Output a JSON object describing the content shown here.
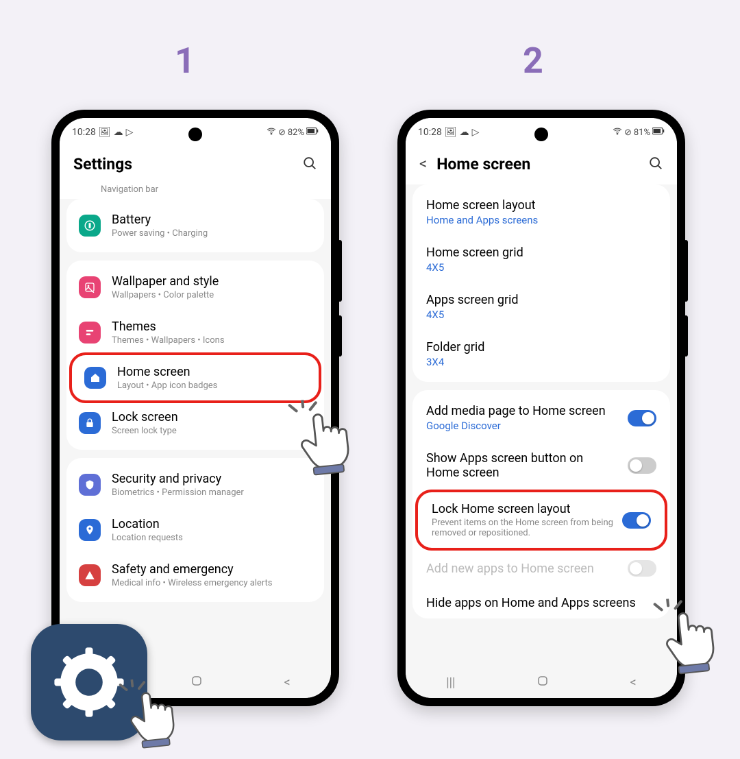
{
  "steps": {
    "s1": "1",
    "s2": "2"
  },
  "status": {
    "time1": "10:28",
    "time2": "10:28",
    "batt1": "82%",
    "batt2": "81%"
  },
  "screen1": {
    "title": "Settings",
    "crumb": "Navigation bar",
    "items": {
      "battery": {
        "title": "Battery",
        "sub": "Power saving  •  Charging"
      },
      "wallpaper": {
        "title": "Wallpaper and style",
        "sub": "Wallpapers  •  Color palette"
      },
      "themes": {
        "title": "Themes",
        "sub": "Themes  •  Wallpapers  •  Icons"
      },
      "home": {
        "title": "Home screen",
        "sub": "Layout  •  App icon badges"
      },
      "lock": {
        "title": "Lock screen",
        "sub": "Screen lock type"
      },
      "security": {
        "title": "Security and privacy",
        "sub": "Biometrics  •  Permission manager"
      },
      "location": {
        "title": "Location",
        "sub": "Location requests"
      },
      "safety": {
        "title": "Safety and emergency",
        "sub": "Medical info  •  Wireless emergency alerts"
      }
    }
  },
  "screen2": {
    "title": "Home screen",
    "items": {
      "layout": {
        "title": "Home screen layout",
        "sub": "Home and Apps screens"
      },
      "hgrid": {
        "title": "Home screen grid",
        "sub": "4X5"
      },
      "agrid": {
        "title": "Apps screen grid",
        "sub": "4X5"
      },
      "fgrid": {
        "title": "Folder grid",
        "sub": "3X4"
      },
      "media": {
        "title": "Add media page to Home screen",
        "sub": "Google Discover"
      },
      "showapps": {
        "title": "Show Apps screen button on Home screen"
      },
      "lock": {
        "title": "Lock Home screen layout",
        "desc": "Prevent items on the Home screen from being removed or repositioned."
      },
      "addnew": {
        "title": "Add new apps to Home screen"
      },
      "hide": {
        "title": "Hide apps on Home and Apps screens"
      }
    }
  }
}
